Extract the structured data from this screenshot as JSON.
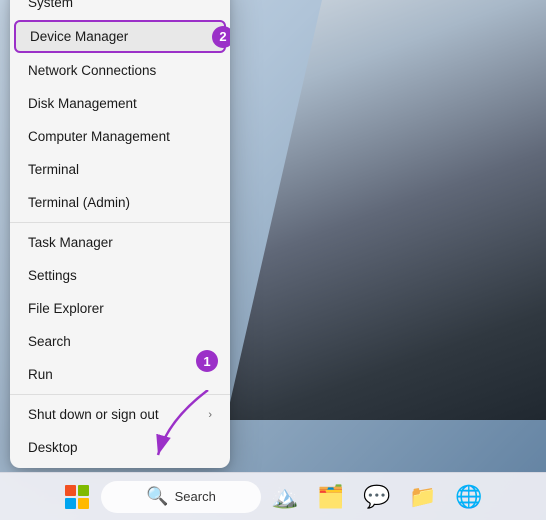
{
  "desktop": {
    "bg_description": "Windows 11 desktop wallpaper"
  },
  "context_menu": {
    "items": [
      {
        "id": "system",
        "label": "System",
        "has_arrow": false,
        "divider_after": false
      },
      {
        "id": "device-manager",
        "label": "Device Manager",
        "has_arrow": false,
        "divider_after": false,
        "highlighted": true
      },
      {
        "id": "network-connections",
        "label": "Network Connections",
        "has_arrow": false,
        "divider_after": false,
        "badge": "2"
      },
      {
        "id": "disk-management",
        "label": "Disk Management",
        "has_arrow": false,
        "divider_after": false
      },
      {
        "id": "computer-management",
        "label": "Computer Management",
        "has_arrow": false,
        "divider_after": false
      },
      {
        "id": "terminal",
        "label": "Terminal",
        "has_arrow": false,
        "divider_after": false
      },
      {
        "id": "terminal-admin",
        "label": "Terminal (Admin)",
        "has_arrow": false,
        "divider_after": true
      },
      {
        "id": "task-manager",
        "label": "Task Manager",
        "has_arrow": false,
        "divider_after": false
      },
      {
        "id": "settings",
        "label": "Settings",
        "has_arrow": false,
        "divider_after": false
      },
      {
        "id": "file-explorer",
        "label": "File Explorer",
        "has_arrow": false,
        "divider_after": false
      },
      {
        "id": "search",
        "label": "Search",
        "has_arrow": false,
        "divider_after": false
      },
      {
        "id": "run",
        "label": "Run",
        "has_arrow": false,
        "divider_after": true
      },
      {
        "id": "shutdown",
        "label": "Shut down or sign out",
        "has_arrow": true,
        "divider_after": false
      },
      {
        "id": "desktop",
        "label": "Desktop",
        "has_arrow": false,
        "divider_after": false
      }
    ]
  },
  "taskbar": {
    "search_placeholder": "Search",
    "icons": [
      {
        "id": "windows-start",
        "label": "Start"
      },
      {
        "id": "search-taskbar",
        "label": "Search"
      },
      {
        "id": "taskview",
        "label": "Task View"
      },
      {
        "id": "widgets",
        "label": "Widgets"
      },
      {
        "id": "teams",
        "label": "Teams"
      },
      {
        "id": "explorer",
        "label": "File Explorer"
      },
      {
        "id": "edge",
        "label": "Microsoft Edge"
      }
    ]
  },
  "badges": {
    "step1": "1",
    "step2": "2"
  },
  "colors": {
    "badge_bg": "#9b30c8",
    "highlight_border": "#9b30c8"
  }
}
